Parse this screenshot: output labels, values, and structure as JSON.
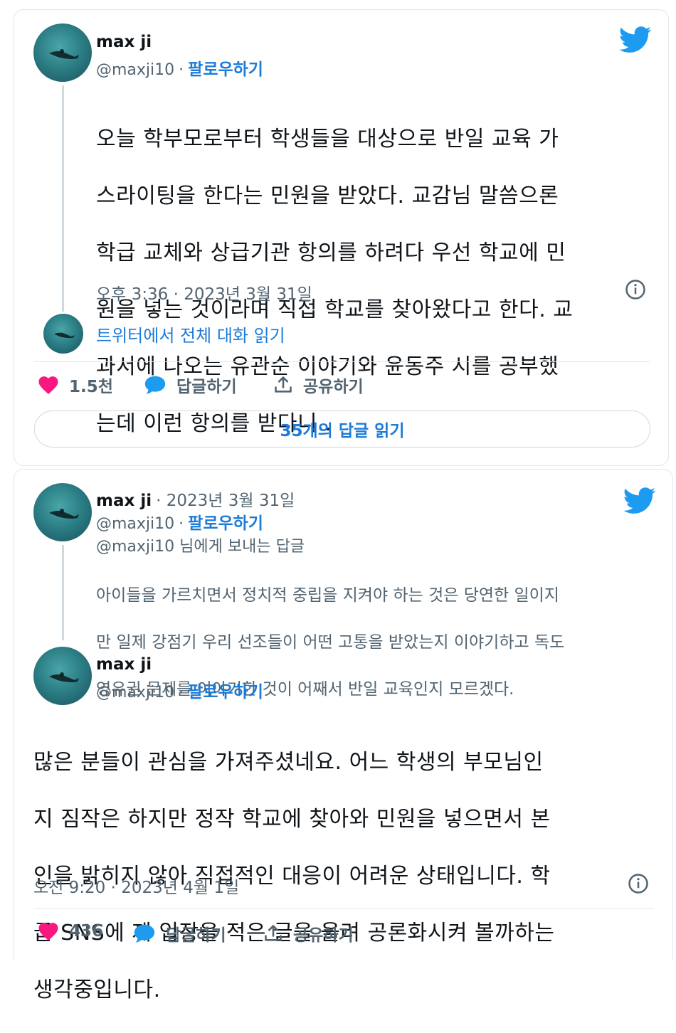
{
  "brand": {
    "twitter_blue": "#1d9bf0",
    "like_pink": "#f91880",
    "link_blue": "#1d7bd8",
    "gray": "#536471"
  },
  "tweet1": {
    "author_name": "max ji",
    "author_handle": "@maxji10",
    "dot": "·",
    "follow_label": "팔로우하기",
    "lines": [
      "오늘 학부모로부터 학생들을 대상으로 반일 교육 가",
      "스라이팅을 한다는 민원을 받았다. 교감님 말씀으론",
      "학급 교체와 상급기관 항의를 하려다 우선 학교에 민",
      "원을 넣는 것이라며 직접 학교를 찾아왔다고 한다. 교",
      "과서에 나오는 유관순 이야기와 윤동주 시를 공부했",
      "는데 이런 항의를 받다니.."
    ],
    "timestamp": "오후 3:36 · 2023년 3월 31일",
    "read_conversation": "트위터에서 전체 대화 읽기",
    "likes": "1.5천",
    "reply_label": "답글하기",
    "share_label": "공유하기",
    "read_replies": "35개의 답글 읽기"
  },
  "tweet2": {
    "reply": {
      "author_name": "max ji",
      "date": "· 2023년 3월 31일",
      "author_handle": "@maxji10",
      "dot": "·",
      "follow_label": "팔로우하기",
      "replying_to": "@maxji10 님에게 보내는 답글",
      "lines": [
        "아이들을 가르치면서 정치적 중립을 지켜야 하는 것은 당연한 일이지",
        "만 일제 강점기 우리 선조들이 어떤 고통을 받았는지 이야기하고 독도",
        "영유권 문제를 이야기한 것이 어째서 반일 교육인지 모르겠다."
      ]
    },
    "main": {
      "author_name": "max ji",
      "author_handle": "@maxji10",
      "dot": "·",
      "follow_label": "팔로우하기",
      "lines": [
        "많은 분들이 관심을 가져주셨네요. 어느 학생의 부모님인",
        "지 짐작은 하지만 정작 학교에 찾아와 민원을 넣으면서 본",
        "인을 밝히지 않아 직접적인 대응이 어려운 상태입니다. 학",
        "급 SNS에 제 입장을 적은 글을 올려 공론화시켜 볼까하는",
        "생각중입니다."
      ],
      "timestamp": "오전 9:20 · 2023년 4월 1일",
      "likes": "436",
      "reply_label": "답글하기",
      "share_label": "공유하기"
    }
  }
}
